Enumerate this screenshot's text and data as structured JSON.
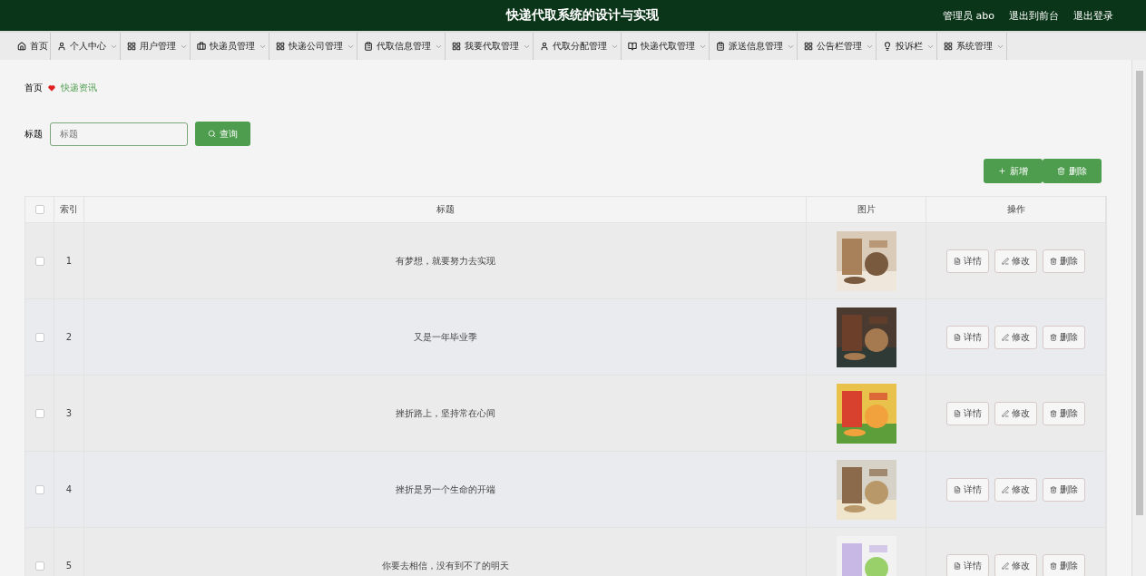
{
  "header": {
    "title": "快递代取系统的设计与实现",
    "links": [
      "管理员 abo",
      "退出到前台",
      "退出登录"
    ]
  },
  "nav": [
    {
      "label": "首页",
      "dropdown": false
    },
    {
      "label": "个人中心",
      "dropdown": true
    },
    {
      "label": "用户管理",
      "dropdown": true
    },
    {
      "label": "快递员管理",
      "dropdown": true
    },
    {
      "label": "快递公司管理",
      "dropdown": true
    },
    {
      "label": "代取信息管理",
      "dropdown": true
    },
    {
      "label": "我要代取管理",
      "dropdown": true
    },
    {
      "label": "代取分配管理",
      "dropdown": true
    },
    {
      "label": "快递代取管理",
      "dropdown": true
    },
    {
      "label": "派送信息管理",
      "dropdown": true
    },
    {
      "label": "公告栏管理",
      "dropdown": true
    },
    {
      "label": "投诉栏",
      "dropdown": true
    },
    {
      "label": "系统管理",
      "dropdown": true
    }
  ],
  "breadcrumb": [
    "首页",
    "快递资讯"
  ],
  "search": {
    "label": "标题",
    "placeholder": "标题",
    "button": "查询"
  },
  "actions": [
    "新增",
    "删除"
  ],
  "table": {
    "all_checked": false,
    "columns": [
      "索引",
      "标题",
      "图片",
      "操作"
    ],
    "rows": [
      {
        "index": "1",
        "title": "有梦想，就要努力去实现",
        "checked": false,
        "buttons": [
          "详情",
          "修改",
          "删除"
        ]
      },
      {
        "index": "2",
        "title": "又是一年毕业季",
        "checked": false,
        "buttons": [
          "详情",
          "修改",
          "删除"
        ]
      },
      {
        "index": "3",
        "title": "挫折路上，坚持常在心间",
        "checked": false,
        "buttons": [
          "详情",
          "修改",
          "删除"
        ]
      },
      {
        "index": "4",
        "title": "挫折是另一个生命的开端",
        "checked": false,
        "buttons": [
          "详情",
          "修改",
          "删除"
        ]
      },
      {
        "index": "5",
        "title": "你要去相信，没有到不了的明天",
        "checked": false,
        "buttons": [
          "详情",
          "修改",
          "删除"
        ]
      }
    ]
  }
}
